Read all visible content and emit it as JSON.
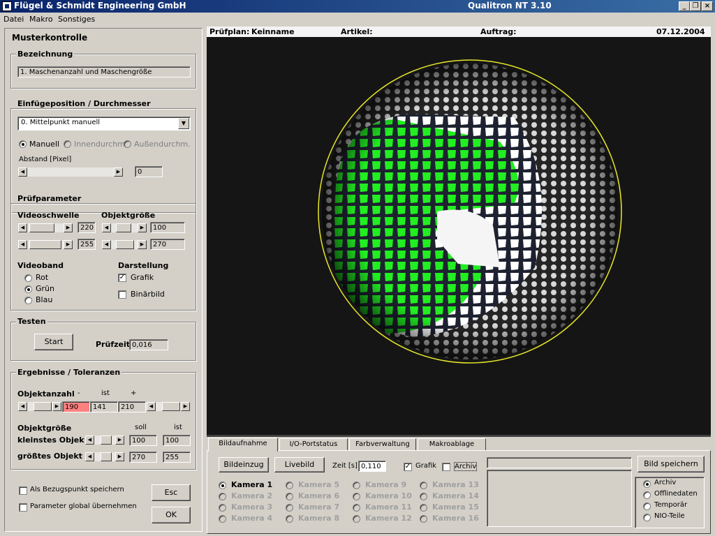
{
  "window": {
    "company": "Flügel & Schmidt  Engineering GmbH",
    "app": "Qualitron NT  3.10"
  },
  "menu": [
    "Datei",
    "Makro",
    "Sonstiges"
  ],
  "panel_title": "Musterkontrolle",
  "bezeichnung": {
    "label": "Bezeichnung",
    "value": "1.  Maschenanzahl und Maschengröße"
  },
  "einfuege": {
    "label": "Einfügeposition / Durchmesser",
    "combo": "0. Mittelpunkt manuell",
    "radios": [
      "Manuell",
      "Innendurchm.",
      "Außendurchm."
    ],
    "selected": "Manuell",
    "abstand_label": "Abstand [Pixel]",
    "abstand_value": "0"
  },
  "pruefparameter": {
    "label": "Prüfparameter",
    "videoschwelle_label": "Videoschwelle",
    "objektgroesse_label": "Objektgröße",
    "videoschwelle_values": [
      "220",
      "255"
    ],
    "objektgroesse_values": [
      "100",
      "270"
    ],
    "videoband_label": "Videoband",
    "videoband_options": [
      "Rot",
      "Grün",
      "Blau"
    ],
    "videoband_selected": "Grün",
    "darstellung_label": "Darstellung",
    "grafik_label": "Grafik",
    "grafik_checked": true,
    "binaer_label": "Binärbild",
    "binaer_checked": false
  },
  "testen": {
    "label": "Testen",
    "start": "Start",
    "pruefzeit_label": "Prüfzeit",
    "pruefzeit": "0,016"
  },
  "ergebnisse": {
    "label": "Ergebnisse / Toleranzen",
    "objektanzahl_label": "Objektanzahl",
    "col_minus": "-",
    "col_ist": "ist",
    "col_plus": "+",
    "anzahl_min": "190",
    "anzahl_ist": "141",
    "anzahl_max": "210",
    "objektgroesse_label": "Objektgröße",
    "soll_label": "soll",
    "ist_label": "ist",
    "kleinstes_label": "kleinstes Objekt",
    "kleinstes_soll": "100",
    "kleinstes_ist": "100",
    "groesstes_label": "größtes Objekt",
    "groesstes_soll": "270",
    "groesstes_ist": "255"
  },
  "bottom": {
    "bezug": "Als Bezugspunkt speichern",
    "global": "Parameter global übernehmen",
    "esc": "Esc",
    "ok": "OK"
  },
  "info": {
    "pruefplan_label": "Prüfplan:",
    "pruefplan": "Keinname",
    "artikel_label": "Artikel:",
    "auftrag_label": "Auftrag:",
    "date": "07.12.2004"
  },
  "tabs": [
    "Bildaufnahme",
    "I/O-Portstatus",
    "Farbverwaltung",
    "Makroablage"
  ],
  "bildaufnahme": {
    "bildeinzug": "Bildeinzug",
    "livebild": "Livebild",
    "zeit_label": "Zeit [s]",
    "zeit": "0,110",
    "grafik": "Grafik",
    "archiv": "Archiv",
    "bild_speichern": "Bild speichern",
    "cameras": [
      "Kamera 1",
      "Kamera 2",
      "Kamera 3",
      "Kamera 4",
      "Kamera 5",
      "Kamera 6",
      "Kamera 7",
      "Kamera 8",
      "Kamera 9",
      "Kamera 10",
      "Kamera 11",
      "Kamera 12",
      "Kamera 13",
      "Kamera 14",
      "Kamera 15",
      "Kamera 16"
    ],
    "save_targets": [
      "Archiv",
      "Offlinedaten",
      "Temporär",
      "NIO-Teile"
    ]
  },
  "colors": {
    "title_start": "#0a246a",
    "title_end": "#3a6ea5",
    "detected_mesh": "#22ee22",
    "circle": "#e6e62a",
    "alarm": "#ff8080"
  }
}
